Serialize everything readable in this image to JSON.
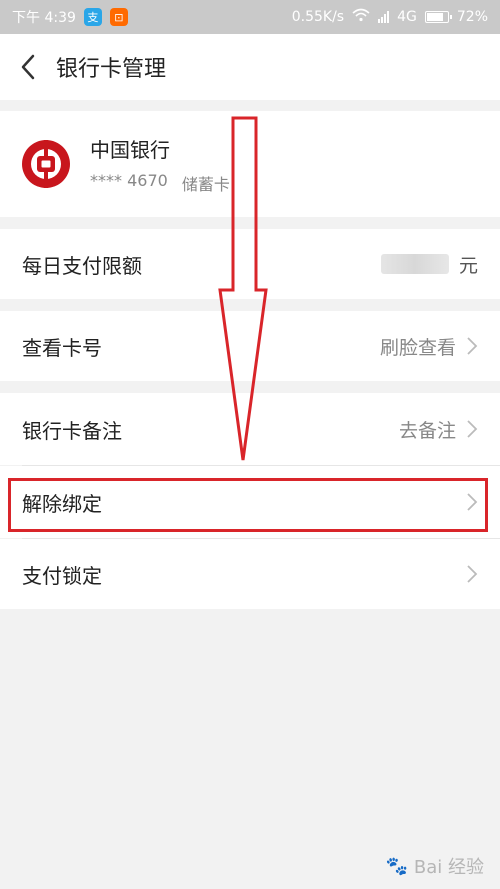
{
  "status_bar": {
    "time": "下午 4:39",
    "app1": "支",
    "app2": "⊡",
    "net_speed": "0.55K/s",
    "net_type": "4G",
    "battery": "72%",
    "battery_level": 0.72
  },
  "header": {
    "title": "银行卡管理"
  },
  "card": {
    "bank_name": "中国银行",
    "card_number": "**** 4670",
    "card_type": "储蓄卡"
  },
  "rows": {
    "daily_limit": {
      "label": "每日支付限额",
      "unit": "元"
    },
    "view_card_number": {
      "label": "查看卡号",
      "action": "刷脸查看"
    },
    "card_note": {
      "label": "银行卡备注",
      "action": "去备注"
    },
    "unbind": {
      "label": "解除绑定"
    },
    "payment_lock": {
      "label": "支付锁定"
    }
  },
  "watermark": {
    "text": "Bai 经验"
  },
  "colors": {
    "accent_red": "#d9252a",
    "bank_red": "#c8161d"
  }
}
